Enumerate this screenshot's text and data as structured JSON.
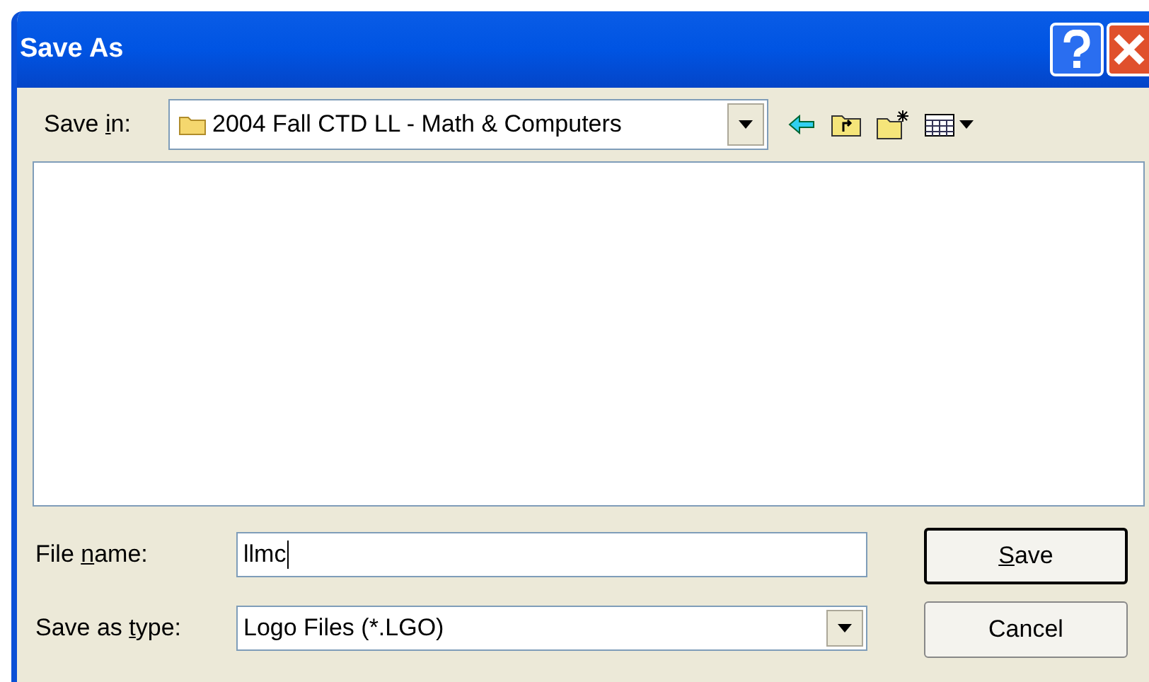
{
  "window": {
    "title": "Save As"
  },
  "save_in": {
    "label": {
      "before": "Save ",
      "key": "i",
      "after": "n:"
    },
    "value": "2004 Fall CTD LL - Math & Computers"
  },
  "file_name": {
    "label": {
      "before": "File ",
      "key": "n",
      "after": "ame:"
    },
    "value": "llmc"
  },
  "save_as_type": {
    "label": {
      "before": "Save as ",
      "key": "t",
      "after": "ype:"
    },
    "value": "Logo Files (*.LGO)"
  },
  "buttons": [
    {
      "label": {
        "key": "S",
        "after": "ave"
      },
      "default": true
    },
    {
      "label": {
        "before": "Cancel"
      },
      "default": false
    }
  ]
}
